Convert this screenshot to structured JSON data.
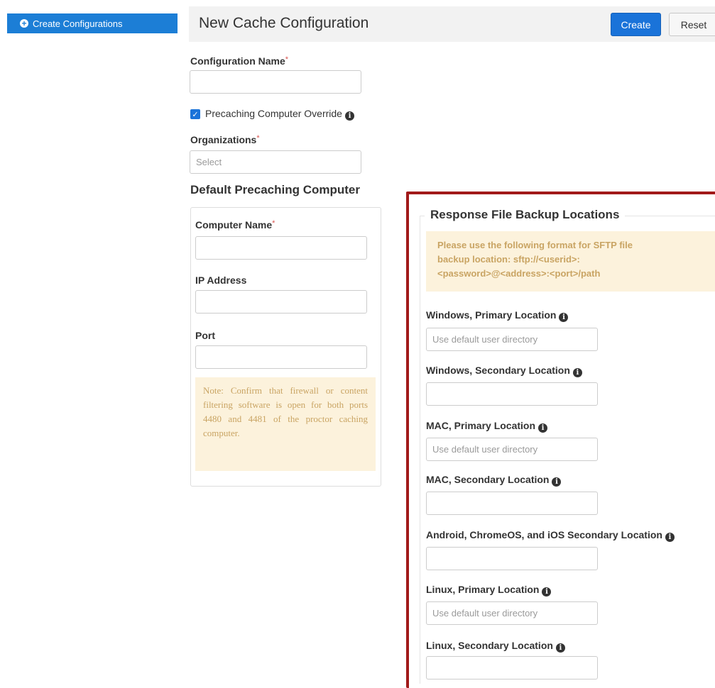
{
  "nav": {
    "create_configurations": "Create Configurations"
  },
  "header": {
    "title": "New Cache Configuration",
    "create_label": "Create",
    "reset_label": "Reset"
  },
  "form": {
    "configuration_name_label": "Configuration Name",
    "required_mark": "*",
    "configuration_name_value": "",
    "override_label": "Precaching Computer Override",
    "override_checked": true,
    "organizations_label": "Organizations",
    "organizations_placeholder": "Select"
  },
  "default_precaching": {
    "title": "Default Precaching Computer",
    "computer_name_label": "Computer Name",
    "ip_address_label": "IP Address",
    "port_label": "Port",
    "note": "Note: Confirm that firewall or content filtering software is open for both ports 4480 and 4481 of the proctor caching computer."
  },
  "backup": {
    "legend": "Response File Backup Locations",
    "sftp_note_lines": [
      "Please use the following format for SFTP file",
      "backup location: sftp://<userid>:",
      "<password>@<address>:<port>/path"
    ],
    "fields": [
      {
        "label": "Windows, Primary Location",
        "placeholder": "Use default user directory"
      },
      {
        "label": "Windows, Secondary Location",
        "placeholder": ""
      },
      {
        "label": "MAC, Primary Location",
        "placeholder": "Use default user directory"
      },
      {
        "label": "MAC, Secondary Location",
        "placeholder": ""
      },
      {
        "label": "Android, ChromeOS, and iOS Secondary Location",
        "placeholder": ""
      },
      {
        "label": "Linux, Primary Location",
        "placeholder": "Use default user directory"
      },
      {
        "label": "Linux, Secondary Location",
        "placeholder": ""
      }
    ]
  },
  "colors": {
    "primary": "#1a73d9",
    "highlight_border": "#a11a1a",
    "note_bg": "#fcf2dc",
    "note_text": "#c9a463"
  }
}
